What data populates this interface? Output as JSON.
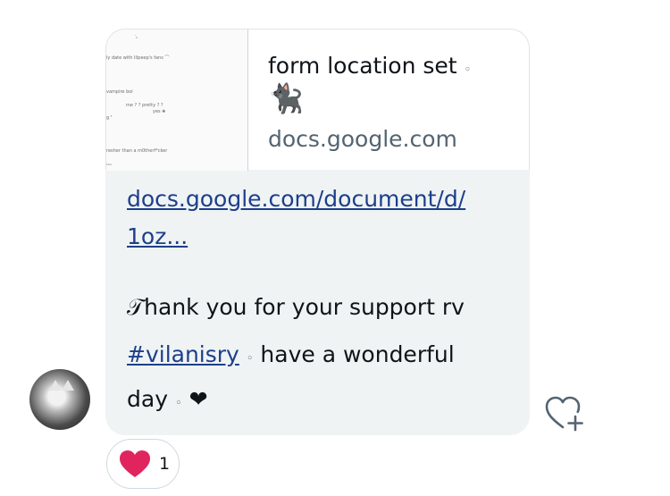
{
  "card": {
    "title": "form location set",
    "title_dot": "◦",
    "emoji": "🐈‍⬛",
    "domain": "docs.google.com",
    "thumbnail_lines": [
      "· ͈͈",
      "ly date with lilpeep's fans  ⌒",
      "vampire boi",
      "me ? ? pretty ? ?",
      "yes ❀",
      "g  ᵀ",
      "resher than a m0therf*cker",
      "ᵀᶦᵐ"
    ]
  },
  "message": {
    "link_line1": "docs.google.com/document/d/",
    "link_line2": "1oz...",
    "thanks": "𝒯hank you for your support rv",
    "hashtag": "#vilanisry",
    "dot": "◦",
    "wish": "have a wonderful",
    "day": "day",
    "heart": "❤"
  },
  "reactions": {
    "count": "1"
  },
  "colors": {
    "bubble_bg": "#eff3f4",
    "link": "#1d3f8a",
    "heart_red": "#e0245e"
  }
}
